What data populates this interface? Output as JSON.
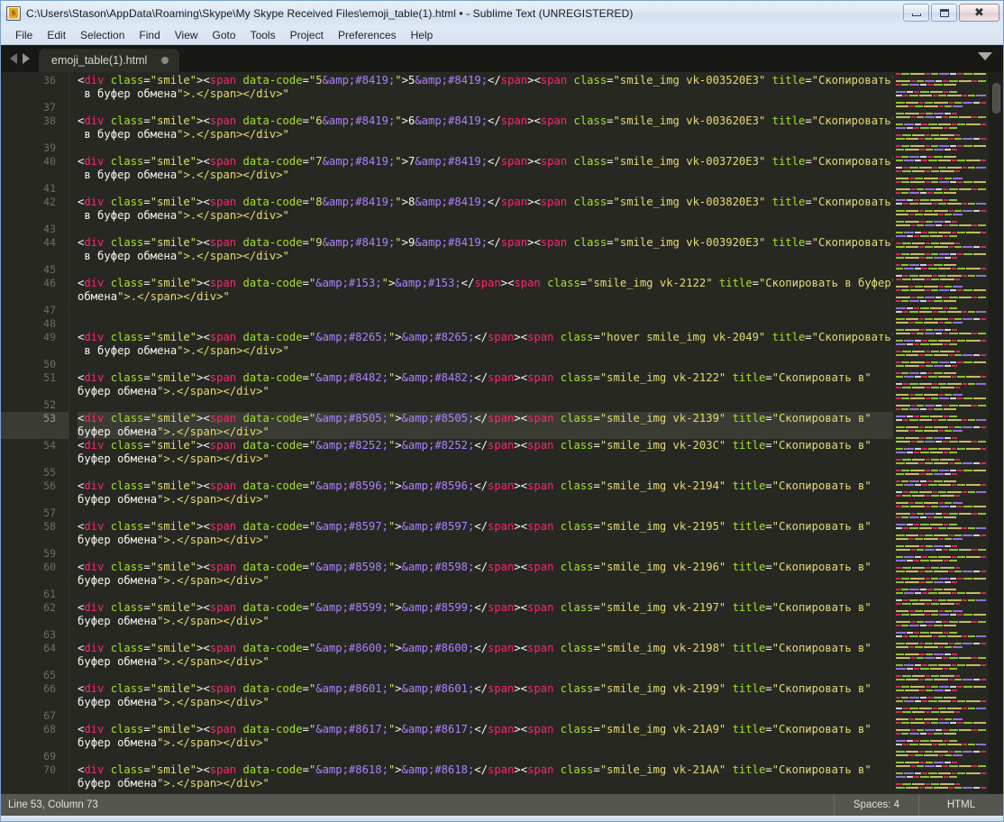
{
  "window": {
    "title": "C:\\Users\\Stason\\AppData\\Roaming\\Skype\\My Skype Received Files\\emoji_table(1).html • - Sublime Text (UNREGISTERED)",
    "app_icon": "sublime-text-icon",
    "icon_glyph": "S",
    "minimize_label": "Minimize",
    "maximize_label": "Maximize",
    "close_label": "Close"
  },
  "menubar": {
    "items": [
      {
        "label": "File"
      },
      {
        "label": "Edit"
      },
      {
        "label": "Selection"
      },
      {
        "label": "Find"
      },
      {
        "label": "View"
      },
      {
        "label": "Goto"
      },
      {
        "label": "Tools"
      },
      {
        "label": "Project"
      },
      {
        "label": "Preferences"
      },
      {
        "label": "Help"
      }
    ]
  },
  "tabbar": {
    "prev_icon": "arrow-left-icon",
    "next_icon": "arrow-right-icon",
    "dropdown_icon": "chevron-down-icon",
    "tabs": [
      {
        "label": "emoji_table(1).html",
        "dirty": true,
        "active": true
      }
    ]
  },
  "editor": {
    "current_line": 53,
    "first_visible_line": 36,
    "lines": [
      {
        "num": 36,
        "wrapped": true,
        "code": "<div class=\"smile\"><span data-code=\"5&amp;#8419;\">5&amp;#8419;</span><span class=\"smile_img vk-003520E3\" title=\"Скопировать\n в буфер обмена\">.</span></div>"
      },
      {
        "num": 37,
        "wrapped": false,
        "code": ""
      },
      {
        "num": 38,
        "wrapped": true,
        "code": "<div class=\"smile\"><span data-code=\"6&amp;#8419;\">6&amp;#8419;</span><span class=\"smile_img vk-003620E3\" title=\"Скопировать\n в буфер обмена\">.</span></div>"
      },
      {
        "num": 39,
        "wrapped": false,
        "code": ""
      },
      {
        "num": 40,
        "wrapped": true,
        "code": "<div class=\"smile\"><span data-code=\"7&amp;#8419;\">7&amp;#8419;</span><span class=\"smile_img vk-003720E3\" title=\"Скопировать\n в буфер обмена\">.</span></div>"
      },
      {
        "num": 41,
        "wrapped": false,
        "code": ""
      },
      {
        "num": 42,
        "wrapped": true,
        "code": "<div class=\"smile\"><span data-code=\"8&amp;#8419;\">8&amp;#8419;</span><span class=\"smile_img vk-003820E3\" title=\"Скопировать\n в буфер обмена\">.</span></div>"
      },
      {
        "num": 43,
        "wrapped": false,
        "code": ""
      },
      {
        "num": 44,
        "wrapped": true,
        "code": "<div class=\"smile\"><span data-code=\"9&amp;#8419;\">9&amp;#8419;</span><span class=\"smile_img vk-003920E3\" title=\"Скопировать\n в буфер обмена\">.</span></div>"
      },
      {
        "num": 45,
        "wrapped": false,
        "code": ""
      },
      {
        "num": 46,
        "wrapped": true,
        "code": "<div class=\"smile\"><span data-code=\"&amp;#153;\">&amp;#153;</span><span class=\"smile_img vk-2122\" title=\"Скопировать в буфер\nобмена\">.</span></div>"
      },
      {
        "num": 47,
        "wrapped": false,
        "code": ""
      },
      {
        "num": 48,
        "wrapped": false,
        "code": ""
      },
      {
        "num": 49,
        "wrapped": true,
        "code": "<div class=\"smile\"><span data-code=\"&amp;#8265;\">&amp;#8265;</span><span class=\"hover smile_img vk-2049\" title=\"Скопировать\n в буфер обмена\">.</span></div>"
      },
      {
        "num": 50,
        "wrapped": false,
        "code": ""
      },
      {
        "num": 51,
        "wrapped": true,
        "code": "<div class=\"smile\"><span data-code=\"&amp;#8482;\">&amp;#8482;</span><span class=\"smile_img vk-2122\" title=\"Скопировать в\nбуфер обмена\">.</span></div>"
      },
      {
        "num": 52,
        "wrapped": false,
        "code": ""
      },
      {
        "num": 53,
        "wrapped": true,
        "code": "<div class=\"smile\"><span data-code=\"&amp;#8505;\">&amp;#8505;</span><span class=\"smile_img vk-2139\" title=\"Скопировать в\nбуфер обмена\">.</span></div>"
      },
      {
        "num": 54,
        "wrapped": true,
        "code": "<div class=\"smile\"><span data-code=\"&amp;#8252;\">&amp;#8252;</span><span class=\"smile_img vk-203C\" title=\"Скопировать в\nбуфер обмена\">.</span></div>"
      },
      {
        "num": 55,
        "wrapped": false,
        "code": ""
      },
      {
        "num": 56,
        "wrapped": true,
        "code": "<div class=\"smile\"><span data-code=\"&amp;#8596;\">&amp;#8596;</span><span class=\"smile_img vk-2194\" title=\"Скопировать в\nбуфер обмена\">.</span></div>"
      },
      {
        "num": 57,
        "wrapped": false,
        "code": ""
      },
      {
        "num": 58,
        "wrapped": true,
        "code": "<div class=\"smile\"><span data-code=\"&amp;#8597;\">&amp;#8597;</span><span class=\"smile_img vk-2195\" title=\"Скопировать в\nбуфер обмена\">.</span></div>"
      },
      {
        "num": 59,
        "wrapped": false,
        "code": ""
      },
      {
        "num": 60,
        "wrapped": true,
        "code": "<div class=\"smile\"><span data-code=\"&amp;#8598;\">&amp;#8598;</span><span class=\"smile_img vk-2196\" title=\"Скопировать в\nбуфер обмена\">.</span></div>"
      },
      {
        "num": 61,
        "wrapped": false,
        "code": ""
      },
      {
        "num": 62,
        "wrapped": true,
        "code": "<div class=\"smile\"><span data-code=\"&amp;#8599;\">&amp;#8599;</span><span class=\"smile_img vk-2197\" title=\"Скопировать в\nбуфер обмена\">.</span></div>"
      },
      {
        "num": 63,
        "wrapped": false,
        "code": ""
      },
      {
        "num": 64,
        "wrapped": true,
        "code": "<div class=\"smile\"><span data-code=\"&amp;#8600;\">&amp;#8600;</span><span class=\"smile_img vk-2198\" title=\"Скопировать в\nбуфер обмена\">.</span></div>"
      },
      {
        "num": 65,
        "wrapped": false,
        "code": ""
      },
      {
        "num": 66,
        "wrapped": true,
        "code": "<div class=\"smile\"><span data-code=\"&amp;#8601;\">&amp;#8601;</span><span class=\"smile_img vk-2199\" title=\"Скопировать в\nбуфер обмена\">.</span></div>"
      },
      {
        "num": 67,
        "wrapped": false,
        "code": ""
      },
      {
        "num": 68,
        "wrapped": true,
        "code": "<div class=\"smile\"><span data-code=\"&amp;#8617;\">&amp;#8617;</span><span class=\"smile_img vk-21A9\" title=\"Скопировать в\nбуфер обмена\">.</span></div>"
      },
      {
        "num": 69,
        "wrapped": false,
        "code": ""
      },
      {
        "num": 70,
        "wrapped": true,
        "code": "<div class=\"smile\"><span data-code=\"&amp;#8618;\">&amp;#8618;</span><span class=\"smile_img vk-21AA\" title=\"Скопировать в\nбуфер обмена\">.</span></div>"
      }
    ]
  },
  "statusbar": {
    "position": "Line 53, Column 73",
    "indentation": "Spaces: 4",
    "syntax": "HTML"
  },
  "colors": {
    "editor_bg": "#272822",
    "tagname": "#f92672",
    "attribute": "#a6e22e",
    "string": "#e6db74",
    "entity": "#ae81ff",
    "plain": "#f8f8f2",
    "gutter_text": "#6d6e67",
    "current_line_bg": "#3a3b33",
    "statusbar_bg": "#55564f",
    "chrome_bg": "#181915",
    "tab_active_bg": "#2d2e28"
  }
}
